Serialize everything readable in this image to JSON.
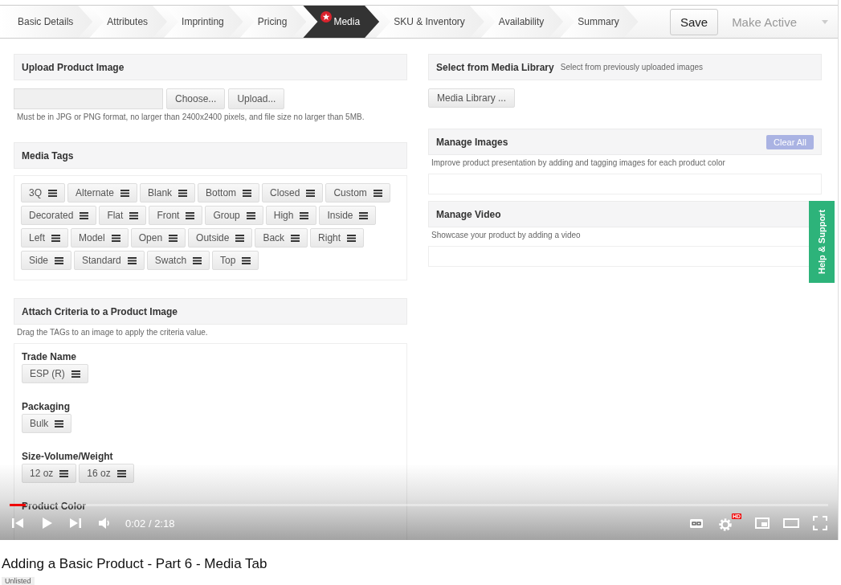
{
  "steps": [
    {
      "label": "Basic Details",
      "selected": false,
      "starred": false
    },
    {
      "label": "Attributes",
      "selected": false,
      "starred": false
    },
    {
      "label": "Imprinting",
      "selected": false,
      "starred": false
    },
    {
      "label": "Pricing",
      "selected": false,
      "starred": false
    },
    {
      "label": "Media",
      "selected": true,
      "starred": true
    },
    {
      "label": "SKU & Inventory",
      "selected": false,
      "starred": false
    },
    {
      "label": "Availability",
      "selected": false,
      "starred": false
    },
    {
      "label": "Summary",
      "selected": false,
      "starred": false
    }
  ],
  "actions": [
    {
      "label": "Save",
      "disabled": false
    },
    {
      "label": "Make Active",
      "disabled": true
    }
  ],
  "upload": {
    "title": "Upload Product Image",
    "buttons": [
      "Choose...",
      "Upload..."
    ],
    "hint": "Must be in JPG or PNG format, no larger than 2400x2400 pixels, and file size no larger than 5MB."
  },
  "media_tags": {
    "title": "Media Tags",
    "tags": [
      "3Q",
      "Alternate",
      "Blank",
      "Bottom",
      "Closed",
      "Custom",
      "Decorated",
      "Flat",
      "Front",
      "Group",
      "High",
      "Inside",
      "Left",
      "Model",
      "Open",
      "Outside",
      "Back",
      "Right",
      "Side",
      "Standard",
      "Swatch",
      "Top"
    ]
  },
  "criteria": {
    "title": "Attach Criteria to a Product Image",
    "hint": "Drag the TAGs to an image to apply the criteria value.",
    "groups": [
      {
        "label": "Trade Name",
        "tags": [
          "ESP (R)"
        ]
      },
      {
        "label": "Packaging",
        "tags": [
          "Bulk"
        ]
      },
      {
        "label": "Size-Volume/Weight",
        "tags": [
          "12 oz",
          "16 oz"
        ]
      },
      {
        "label": "Product Color"
      }
    ]
  },
  "media_library": {
    "title": "Select from Media Library",
    "subtitle": "Select from previously uploaded images",
    "button": "Media Library ..."
  },
  "manage_images": {
    "title": "Manage Images",
    "button": "Clear All",
    "description": "Improve product presentation by adding and tagging images for each product color"
  },
  "manage_video": {
    "title": "Manage Video",
    "description": "Showcase your product by adding a video"
  },
  "help_tab": "Help & Support",
  "player": {
    "progress": {
      "level": 0.02
    },
    "time": "0:02 / 2:18",
    "hd_badge": "HD"
  },
  "video_title": "Adding a Basic Product - Part 6 - Media Tab",
  "visibility": "Unlisted"
}
